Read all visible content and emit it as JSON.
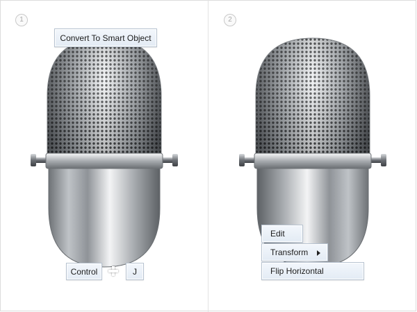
{
  "steps": [
    {
      "number": "1",
      "convert_label": "Convert To Smart Object",
      "shortcut": {
        "modifier_label": "Control",
        "key_label": "J"
      }
    },
    {
      "number": "2",
      "menu": {
        "edit_label": "Edit",
        "transform_label": "Transform",
        "flip_label": "Flip Horizontal"
      }
    }
  ],
  "icons": {
    "microphone": "microphone-illustration",
    "plus": "plus-icon",
    "submenu": "chevron-right-icon"
  },
  "colors": {
    "button_top": "#f3f7fc",
    "button_bottom": "#e3ebf4",
    "button_border": "#b7c3d1",
    "badge_text": "#a9a9a9",
    "divider": "#e2e2e2"
  }
}
